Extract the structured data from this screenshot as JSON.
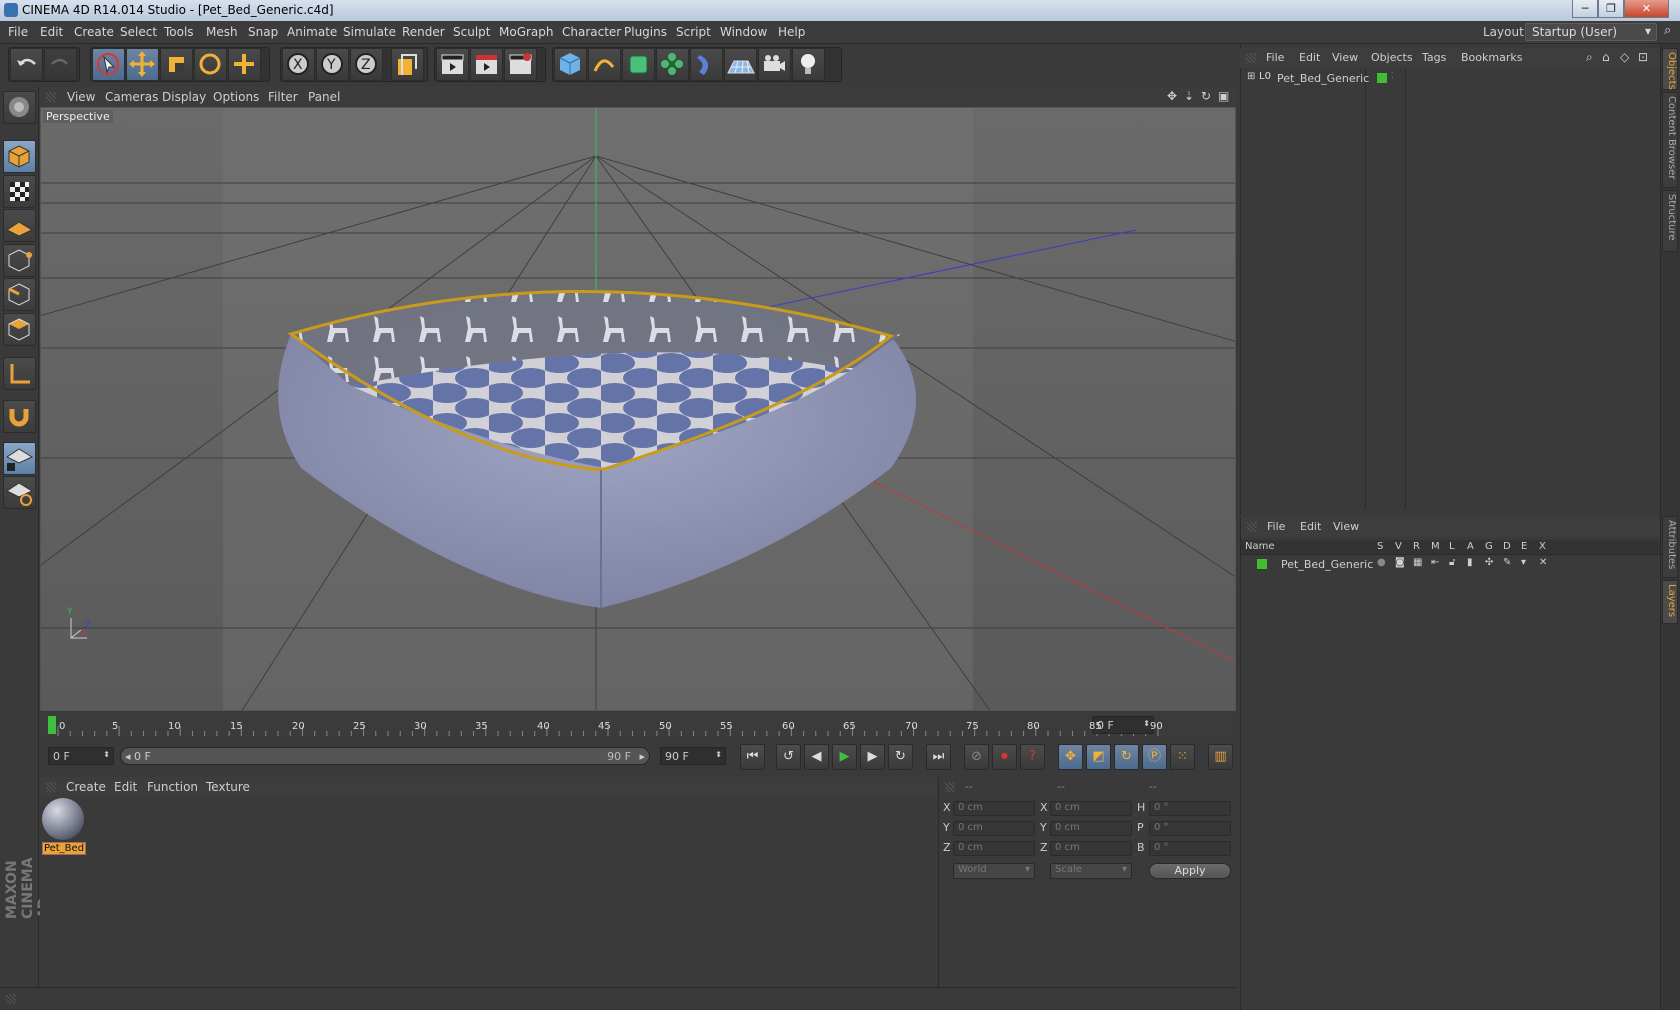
{
  "titlebar": {
    "title": "CINEMA 4D R14.014 Studio - [Pet_Bed_Generic.c4d]"
  },
  "menubar": {
    "items": [
      "File",
      "Edit",
      "Create",
      "Select",
      "Tools",
      "Mesh",
      "Snap",
      "Animate",
      "Simulate",
      "Render",
      "Sculpt",
      "MoGraph",
      "Character",
      "Plugins",
      "Script",
      "Window",
      "Help"
    ],
    "layout_label": "Layout:",
    "layout_value": "Startup (User)"
  },
  "viewport": {
    "menu": [
      "View",
      "Cameras",
      "Display",
      "Options",
      "Filter",
      "Panel"
    ],
    "label": "Perspective",
    "axis": {
      "y": "Y",
      "x": "X",
      "z": "Z"
    }
  },
  "timeline": {
    "ticks": [
      "0",
      "5",
      "10",
      "15",
      "20",
      "25",
      "30",
      "35",
      "40",
      "45",
      "50",
      "55",
      "60",
      "65",
      "70",
      "75",
      "80",
      "85",
      "90"
    ],
    "current_frame": "0 F",
    "start_field": "0 F",
    "range_start": "0 F",
    "range_end": "90 F",
    "end_field": "90 F"
  },
  "material_panel": {
    "menu": [
      "Create",
      "Edit",
      "Function",
      "Texture"
    ],
    "material_name": "Pet_Bed"
  },
  "coord_panel": {
    "headers": [
      "--",
      "--",
      "--"
    ],
    "rows": [
      {
        "a": "X",
        "av": "0 cm",
        "b": "X",
        "bv": "0 cm",
        "c": "H",
        "cv": "0 °"
      },
      {
        "a": "Y",
        "av": "0 cm",
        "b": "Y",
        "bv": "0 cm",
        "c": "P",
        "cv": "0 °"
      },
      {
        "a": "Z",
        "av": "0 cm",
        "b": "Z",
        "bv": "0 cm",
        "c": "B",
        "cv": "0 °"
      }
    ],
    "world": "World",
    "scale": "Scale",
    "apply": "Apply"
  },
  "object_manager": {
    "menu": [
      "File",
      "Edit",
      "View",
      "Objects",
      "Tags",
      "Bookmarks"
    ],
    "object_name": "Pet_Bed_Generic"
  },
  "layer_manager": {
    "menu": [
      "File",
      "Edit",
      "View"
    ],
    "columns": [
      "Name",
      "S",
      "V",
      "R",
      "M",
      "L",
      "A",
      "G",
      "D",
      "E",
      "X"
    ],
    "layer_name": "Pet_Bed_Generic"
  },
  "side_tabs": [
    "Objects",
    "Content Browser",
    "Structure",
    "Attributes",
    "Layers"
  ],
  "brand": "MAXON CINEMA 4D",
  "colors": {
    "accent": "#e8a33a",
    "layer_green": "#3fbf2f",
    "selection_blue": "#5c7fa5"
  }
}
